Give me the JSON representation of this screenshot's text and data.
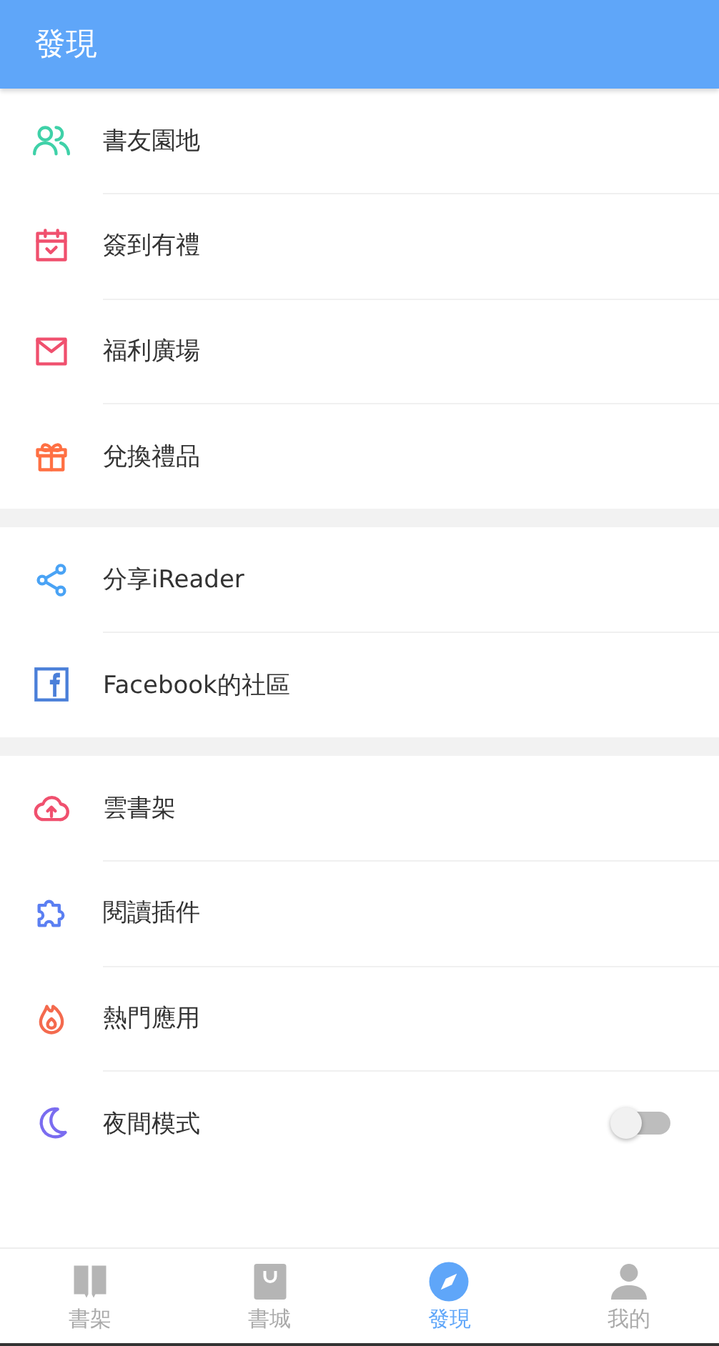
{
  "header": {
    "title": "發現"
  },
  "groups": [
    {
      "items": [
        {
          "kind": "link",
          "label": "書友園地"
        },
        {
          "kind": "link",
          "label": "簽到有禮"
        },
        {
          "kind": "link",
          "label": "福利廣場"
        },
        {
          "kind": "link",
          "label": "兌換禮品"
        }
      ]
    },
    {
      "items": [
        {
          "kind": "link",
          "label": "分享iReader"
        },
        {
          "kind": "link",
          "label": "Facebook的社區"
        }
      ]
    },
    {
      "items": [
        {
          "kind": "link",
          "label": "雲書架"
        },
        {
          "kind": "link",
          "label": "閱讀插件"
        },
        {
          "kind": "link",
          "label": "熱門應用"
        },
        {
          "kind": "toggle",
          "label": "夜間模式",
          "on": false
        }
      ]
    }
  ],
  "tabs": [
    {
      "label": "書架",
      "selected": false
    },
    {
      "label": "書城",
      "selected": false
    },
    {
      "label": "發現",
      "selected": true
    },
    {
      "label": "我的",
      "selected": false
    }
  ]
}
